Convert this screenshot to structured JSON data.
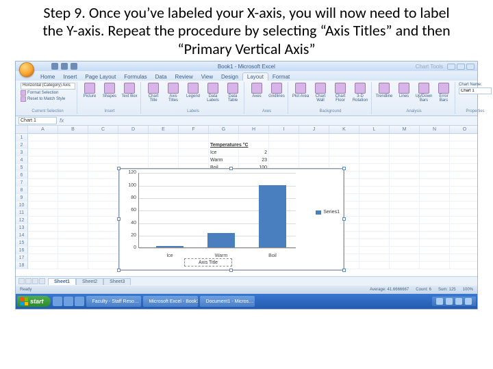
{
  "slide": {
    "title": "Step 9. Once you’ve labeled your X-axis, you will now need to label the Y-axis. Repeat the procedure by selecting “Axis Titles” and then “Primary Vertical Axis”"
  },
  "titlebar": {
    "doc": "Book1 - Microsoft Excel",
    "context": "Chart Tools"
  },
  "tabs": [
    "Home",
    "Insert",
    "Page Layout",
    "Formulas",
    "Data",
    "Review",
    "View",
    "Design",
    "Layout",
    "Format"
  ],
  "active_tab": "Layout",
  "ribbon": {
    "selection": {
      "label": "Current Selection",
      "items": [
        "Format Selection",
        "Reset to Match Style"
      ],
      "dropdown": "Horizontal (Category) Axis"
    },
    "insert": {
      "label": "Insert",
      "items": [
        "Picture",
        "Shapes",
        "Text Box"
      ]
    },
    "labels": {
      "label": "Labels",
      "items": [
        "Chart Title",
        "Axis Titles",
        "Legend",
        "Data Labels",
        "Data Table"
      ]
    },
    "axes": {
      "label": "Axes",
      "items": [
        "Axes",
        "Gridlines"
      ]
    },
    "background": {
      "label": "Background",
      "items": [
        "Plot Area",
        "Chart Wall",
        "Chart Floor",
        "3-D Rotation"
      ]
    },
    "analysis": {
      "label": "Analysis",
      "items": [
        "Trendline",
        "Lines",
        "Up/Down Bars",
        "Error Bars"
      ]
    },
    "properties": {
      "label": "Properties",
      "name_label": "Chart Name:",
      "name_value": "Chart 1"
    }
  },
  "namebox": "Chart 1",
  "columns": [
    "A",
    "B",
    "C",
    "D",
    "E",
    "F",
    "G",
    "H",
    "I",
    "J",
    "K",
    "L",
    "M",
    "N",
    "O"
  ],
  "sheet": {
    "title": "Temperatures °C",
    "rows": [
      {
        "label": "Ice",
        "val": "2"
      },
      {
        "label": "Warm",
        "val": "23"
      },
      {
        "label": "Boil",
        "val": "100"
      }
    ]
  },
  "chart_data": {
    "type": "bar",
    "categories": [
      "Ice",
      "Warm",
      "Boil"
    ],
    "values": [
      2,
      23,
      100
    ],
    "title": "",
    "xlabel": "Axis Title",
    "ylabel": "",
    "ylim": [
      0,
      120
    ],
    "yticks": [
      0,
      20,
      40,
      60,
      80,
      100,
      120
    ],
    "series": [
      {
        "name": "Series1",
        "values": [
          2,
          23,
          100
        ]
      }
    ]
  },
  "legend": "Series1",
  "axis_title_placeholder": "Axis Title",
  "sheet_tabs": [
    "Sheet1",
    "Sheet2",
    "Sheet3"
  ],
  "status": {
    "mode": "Ready",
    "avg": "Average: 41.6666667",
    "count": "Count: 6",
    "sum": "Sum: 125",
    "zoom": "100%"
  },
  "taskbar": {
    "start": "start",
    "items": [
      "Faculty - Staff Reso…",
      "Microsoft Excel - Book1",
      "Document1 - Micros…"
    ]
  }
}
